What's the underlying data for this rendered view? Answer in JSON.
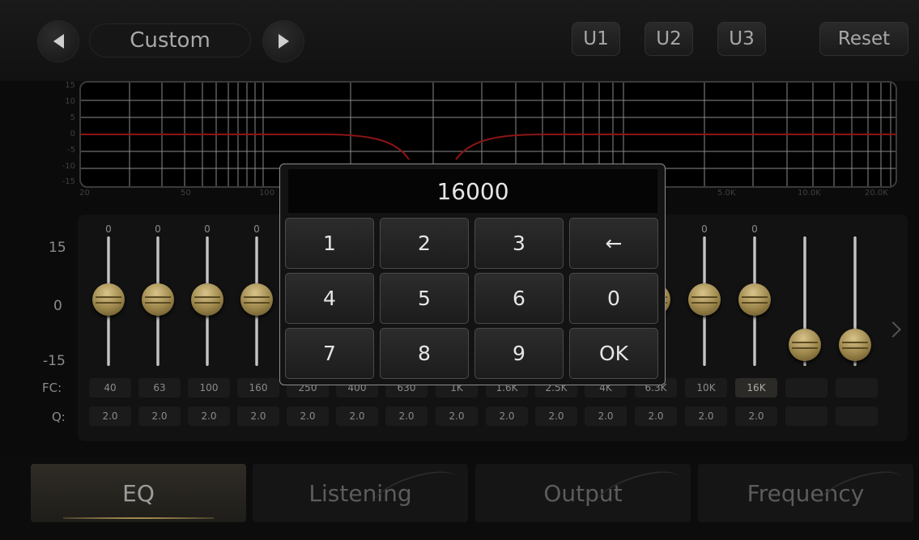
{
  "preset": {
    "name": "Custom",
    "prev_icon": "triangle-left-icon",
    "next_icon": "triangle-right-icon"
  },
  "user_presets": [
    "U1",
    "U2",
    "U3"
  ],
  "reset_label": "Reset",
  "graph": {
    "y_labels": [
      "15",
      "10",
      "5",
      "0",
      "-5",
      "-10",
      "-15"
    ],
    "x_labels": [
      "20",
      "50",
      "100",
      "5.0K",
      "10.0K",
      "20.0K"
    ],
    "curve_color": "#8b1515"
  },
  "scale_labels": [
    "15",
    "0",
    "-15"
  ],
  "row_labels": {
    "fc": "FC:",
    "q": "Q:"
  },
  "bands": [
    {
      "gain": "0",
      "fc": "40",
      "q": "2.0"
    },
    {
      "gain": "0",
      "fc": "63",
      "q": "2.0"
    },
    {
      "gain": "0",
      "fc": "100",
      "q": "2.0"
    },
    {
      "gain": "0",
      "fc": "160",
      "q": "2.0"
    },
    {
      "gain": "",
      "fc": "250",
      "q": "2.0"
    },
    {
      "gain": "",
      "fc": "400",
      "q": "2.0"
    },
    {
      "gain": "",
      "fc": "630",
      "q": "2.0"
    },
    {
      "gain": "",
      "fc": "1K",
      "q": "2.0"
    },
    {
      "gain": "",
      "fc": "1.6K",
      "q": "2.0"
    },
    {
      "gain": "",
      "fc": "2.5K",
      "q": "2.0"
    },
    {
      "gain": "",
      "fc": "4K",
      "q": "2.0"
    },
    {
      "gain": "",
      "fc": "6.3K",
      "q": "2.0"
    },
    {
      "gain": "0",
      "fc": "10K",
      "q": "2.0"
    },
    {
      "gain": "0",
      "fc": "16K",
      "q": "2.0",
      "selected": true
    },
    {
      "gain": "",
      "fc": "",
      "q": ""
    },
    {
      "gain": "",
      "fc": "",
      "q": ""
    }
  ],
  "tabs": [
    "EQ",
    "Listening",
    "Output",
    "Frequency"
  ],
  "active_tab": "EQ",
  "keypad": {
    "value": "16000",
    "keys": [
      "1",
      "2",
      "3",
      "←",
      "4",
      "5",
      "6",
      "0",
      "7",
      "8",
      "9",
      "OK"
    ]
  },
  "accent_color": "#e6c46c"
}
